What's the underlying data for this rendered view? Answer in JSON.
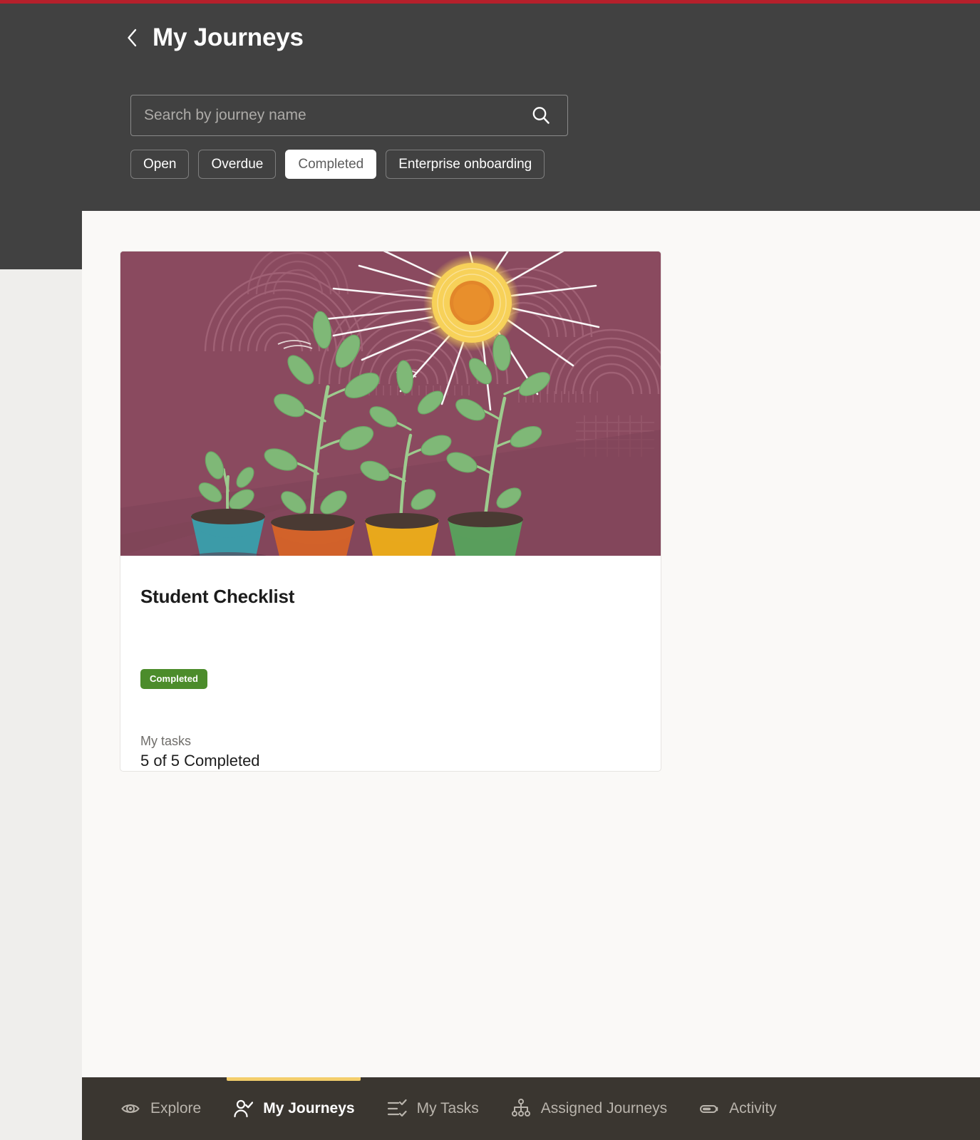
{
  "window": {
    "accent_strip_color": "#B5202B",
    "header_bg": "#414141",
    "content_bg": "#FAF9F7",
    "gutter_bg": "#EFEEEC",
    "nav_bg": "#3A3630"
  },
  "header": {
    "back_label": "Back",
    "title": "My Journeys"
  },
  "search": {
    "placeholder": "Search by journey name",
    "value": "",
    "icon": "search-icon"
  },
  "filters": {
    "chips": [
      {
        "label": "Open",
        "active": false
      },
      {
        "label": "Overdue",
        "active": false
      },
      {
        "label": "Completed",
        "active": true
      },
      {
        "label": "Enterprise onboarding",
        "active": false
      }
    ]
  },
  "cards": [
    {
      "title": "Student Checklist",
      "status": "Completed",
      "status_color": "#4C8C2B",
      "tasks_label": "My tasks",
      "tasks_value": "5 of 5 Completed",
      "hero": {
        "background": "#8A4A5F",
        "pattern_color": "#A4667A",
        "sun_core": "#E2862A",
        "sun_halo": "#F7D159",
        "ray_color": "#FFFFFF",
        "pots": [
          {
            "color": "#3C9BA8",
            "name": "teal-pot"
          },
          {
            "color": "#D2622A",
            "name": "orange-pot"
          },
          {
            "color": "#E8A81C",
            "name": "yellow-pot"
          },
          {
            "color": "#5A9E5C",
            "name": "green-pot"
          }
        ],
        "leaf_color": "#7FB877",
        "soil_color": "#4A3A33"
      }
    }
  ],
  "bottom_nav": {
    "active_indicator_color": "#F3CE6B",
    "items": [
      {
        "label": "Explore",
        "icon": "eye-icon",
        "active": false
      },
      {
        "label": "My Journeys",
        "icon": "person-check-icon",
        "active": true
      },
      {
        "label": "My Tasks",
        "icon": "checklist-icon",
        "active": false
      },
      {
        "label": "Assigned Journeys",
        "icon": "hierarchy-icon",
        "active": false
      },
      {
        "label": "Activity",
        "icon": "battery-icon",
        "active": false
      }
    ]
  }
}
